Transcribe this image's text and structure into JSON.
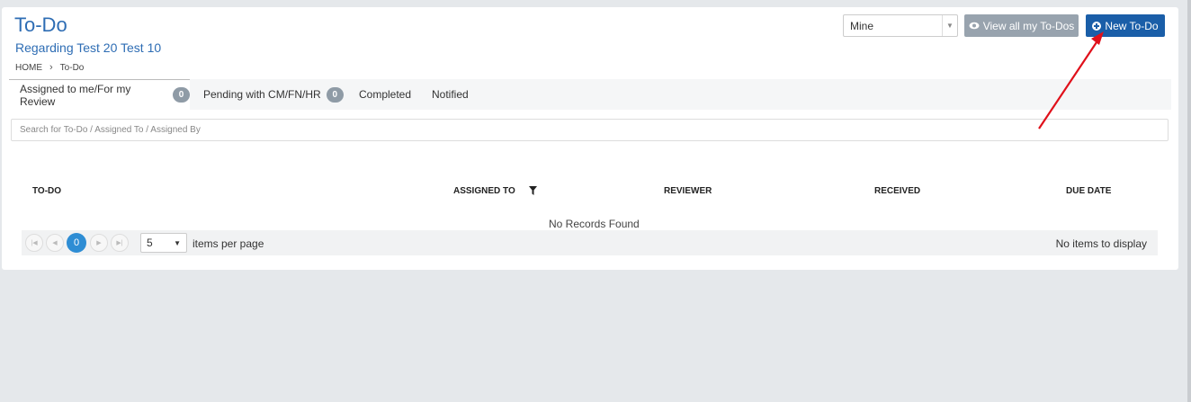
{
  "header": {
    "title": "To-Do",
    "subtitle": "Regarding Test 20 Test 10",
    "breadcrumb": [
      "HOME",
      "To-Do"
    ]
  },
  "toolbar": {
    "scope_select_value": "Mine",
    "view_all_label": "View all my To-Dos",
    "new_todo_label": "New To-Do"
  },
  "tabs": [
    {
      "label": "Assigned to me/For my Review",
      "badge": "0"
    },
    {
      "label": "Pending with CM/FN/HR",
      "badge": "0"
    },
    {
      "label": "Completed"
    },
    {
      "label": "Notified"
    }
  ],
  "search": {
    "placeholder": "Search for To-Do / Assigned To / Assigned By"
  },
  "table": {
    "columns": [
      "TO-DO",
      "ASSIGNED TO",
      "REVIEWER",
      "RECEIVED",
      "DUE DATE"
    ],
    "empty_message": "No Records Found"
  },
  "pager": {
    "current_page": "0",
    "page_size": "5",
    "per_page_label": "items per page",
    "status": "No items to display"
  },
  "colors": {
    "accent": "#2e6db4",
    "primary_button": "#1a5ea8",
    "secondary_button": "#98a3ae",
    "annotation_arrow": "#e0101a"
  }
}
